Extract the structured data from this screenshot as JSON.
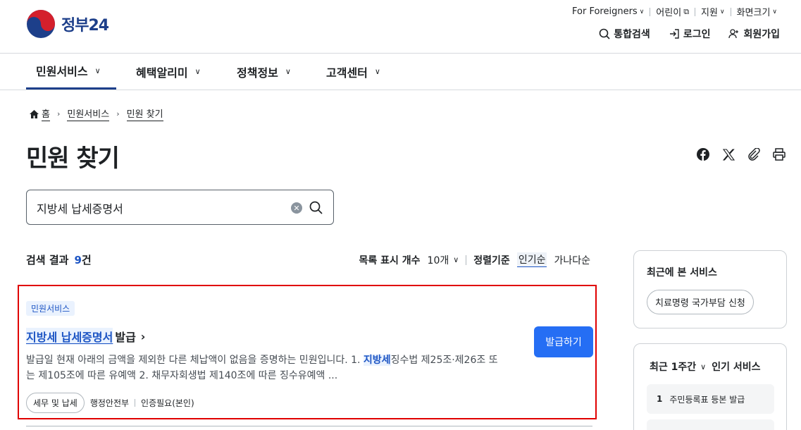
{
  "header": {
    "logo_text": "정부",
    "logo_num": "24",
    "util_links": [
      "For Foreigners",
      "어린이",
      "지원",
      "화면크기"
    ],
    "actions": [
      "통합검색",
      "로그인",
      "회원가입"
    ]
  },
  "nav": {
    "items": [
      "민원서비스",
      "혜택알리미",
      "정책정보",
      "고객센터"
    ],
    "active": "민원서비스"
  },
  "breadcrumb": [
    "홈",
    "민원서비스",
    "민원 찾기"
  ],
  "page_title": "민원 찾기",
  "search": {
    "value": "지방세 납세증명서",
    "placeholder": ""
  },
  "results": {
    "label": "검색 결과",
    "count": "9",
    "count_unit": "건",
    "page_size_label": "목록 표시 개수",
    "page_size_value": "10개",
    "sort_label": "정렬기준",
    "sort_options": [
      "인기순",
      "가나다순"
    ],
    "sort_selected": "인기순"
  },
  "card": {
    "tag": "민원서비스",
    "title_highlight": "지방세 납세증명서",
    "title_rest": "발급",
    "desc_part1": "발급일 현재 아래의 금액을 제외한 다른 체납액이 없음을 증명하는 민원입니다. 1. ",
    "desc_keyword": "지방세",
    "desc_part2": "징수법 제25조·제26조 또는 제105조에 따른 유예액 2. 채무자회생법 제140조에 따른 징수유예액 ...",
    "category": "세무 및 납세",
    "agency": "행정안전부",
    "auth": "인증필요(본인)",
    "action": "발급하기"
  },
  "sidebar": {
    "recent_title": "최근에 본 서비스",
    "recent_items": [
      "치료명령 국가부담 신청"
    ],
    "popular_period": "최근 1주간",
    "popular_title": "인기 서비스",
    "popular_items": [
      {
        "rank": "1",
        "label": "주민등록표 등본 발급"
      }
    ]
  },
  "colors": {
    "brand": "#1d3f8a",
    "accent": "#256ef4",
    "highlight": "#1d55c4",
    "focus_border": "#e00000"
  }
}
